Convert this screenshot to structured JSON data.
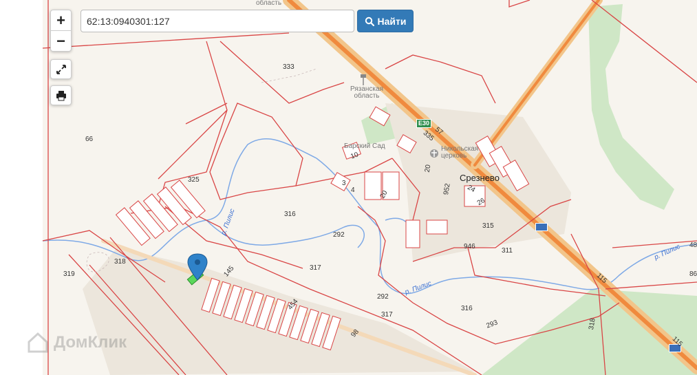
{
  "search": {
    "value": "62:13:0940301:127",
    "button_label": "Найти"
  },
  "controls": {
    "zoom_in": "+",
    "zoom_out": "−"
  },
  "icons": {
    "fullscreen": "expand-icon",
    "print": "print-icon",
    "search": "search-icon",
    "pin": "map-marker-icon"
  },
  "colors": {
    "parcel_border": "#d94545",
    "road": "#f4a259",
    "forest": "#cde8c4",
    "accent": "#337ab7"
  },
  "places": {
    "oblast": "Рязанская область",
    "oblast_top": "область",
    "village": "Срезнево",
    "church": "Никольская церковь",
    "garden": "Барский Сад",
    "road_ref": "E30",
    "watermark": "ДомКлик"
  },
  "parcel_numbers": {
    "p333": "333",
    "p66": "66",
    "p325": "325",
    "p316a": "316",
    "p292a": "292",
    "p317a": "317",
    "p318a": "318",
    "p319": "319",
    "p145": "145",
    "p454": "454",
    "p98": "98",
    "p292b": "292",
    "p317b": "317",
    "p316b": "316",
    "p293": "293",
    "p318b": "318",
    "p115a": "115",
    "p115b": "115",
    "p311": "311",
    "p946": "946",
    "p315": "315",
    "p952": "952",
    "p20a": "20",
    "p20b": "20",
    "p24": "24",
    "p26": "26",
    "p10": "10",
    "p3": "3",
    "p4": "4",
    "p335": "335",
    "p57": "57",
    "p48": "48",
    "p86": "86"
  },
  "rivers": {
    "r1": "р. Пилис",
    "r2": "р. Пилис",
    "r3": "р. Пилис",
    "r4": "р. Пилис"
  }
}
